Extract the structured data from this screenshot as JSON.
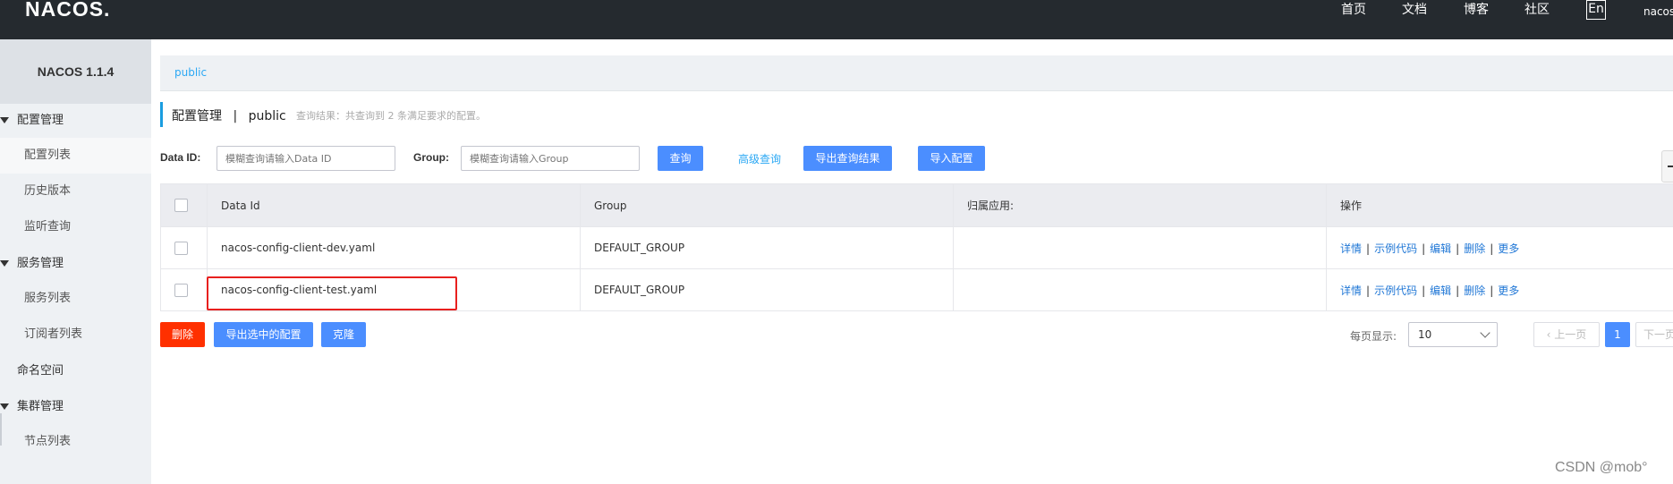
{
  "header": {
    "logo": "NACOS.",
    "nav": [
      "首页",
      "文档",
      "博客",
      "社区"
    ],
    "lang": "En",
    "user": "nacos"
  },
  "sidebar": {
    "version": "NACOS 1.1.4",
    "groups": [
      {
        "label": "配置管理",
        "items": [
          "配置列表",
          "历史版本",
          "监听查询"
        ]
      },
      {
        "label": "服务管理",
        "items": [
          "服务列表",
          "订阅者列表"
        ]
      },
      {
        "label": "命名空间"
      },
      {
        "label": "集群管理",
        "items": [
          "节点列表"
        ]
      }
    ]
  },
  "breadcrumb": {
    "namespace": "public"
  },
  "page": {
    "title": "配置管理",
    "divider": "|",
    "namespace": "public",
    "result": "查询结果：共查询到 2 条满足要求的配置。"
  },
  "filters": {
    "dataid_label": "Data ID:",
    "dataid_placeholder": "模糊查询请输入Data ID",
    "group_label": "Group:",
    "group_placeholder": "模糊查询请输入Group",
    "query": "查询",
    "advanced": "高级查询",
    "export_results": "导出查询结果",
    "import": "导入配置"
  },
  "table": {
    "columns": [
      "Data Id",
      "Group",
      "归属应用:",
      "操作"
    ],
    "rows": [
      {
        "data_id": "nacos-config-client-dev.yaml",
        "group": "DEFAULT_GROUP",
        "app": ""
      },
      {
        "data_id": "nacos-config-client-test.yaml",
        "group": "DEFAULT_GROUP",
        "app": ""
      }
    ],
    "actions": [
      "详情",
      "示例代码",
      "编辑",
      "删除",
      "更多"
    ],
    "highlight_color": "#e8201f"
  },
  "footer": {
    "delete": "删除",
    "export_selected": "导出选中的配置",
    "clone": "克隆",
    "page_size_label": "每页显示:",
    "page_size": "10",
    "prev": "上一页",
    "page": "1",
    "next": "下一页"
  },
  "watermark": "CSDN @mob°"
}
